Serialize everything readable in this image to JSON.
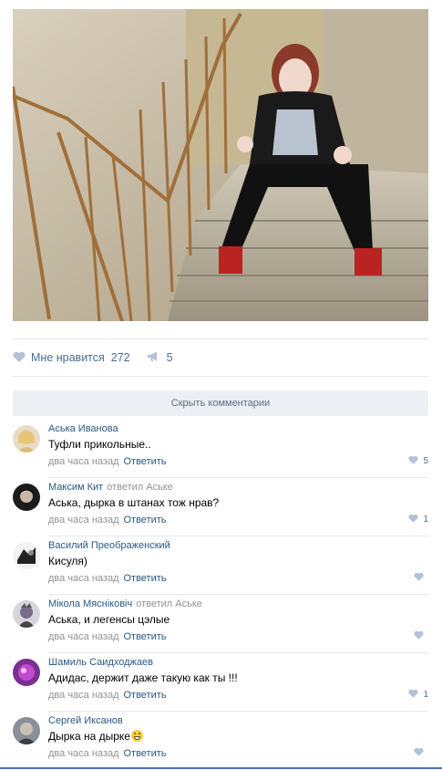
{
  "post": {
    "photo_alt": "",
    "like_label": "Мне нравится",
    "like_count": "272",
    "share_count": "5"
  },
  "comments_section": {
    "hide_label": "Скрыть комментарии"
  },
  "comments": [
    {
      "author": "Аська Иванова",
      "replied_to": "",
      "text": "Туфли прикольные..",
      "time": "два часа назад",
      "reply_label": "Ответить",
      "likes": "5"
    },
    {
      "author": "Максим Кит",
      "replied_to": "ответил Аське",
      "text": "Аська, дырка в штанах тож нрав?",
      "time": "два часа назад",
      "reply_label": "Ответить",
      "likes": "1"
    },
    {
      "author": "Василий Преображенский",
      "replied_to": "",
      "text": "Кисуля)",
      "time": "два часа назад",
      "reply_label": "Ответить",
      "likes": ""
    },
    {
      "author": "Мікола Мясніковіч",
      "replied_to": "ответил Аське",
      "text": "Аська, и легенсы цэлые",
      "time": "два часа назад",
      "reply_label": "Ответить",
      "likes": ""
    },
    {
      "author": "Шамиль Саидходжаев",
      "replied_to": "",
      "text": "Адидас, держит даже такую как ты !!!",
      "time": "два часа назад",
      "reply_label": "Ответить",
      "likes": "1"
    },
    {
      "author": "Сергей Иксанов",
      "replied_to": "",
      "text": "Дырка на дырке",
      "time": "два часа назад",
      "reply_label": "Ответить",
      "likes": ""
    }
  ],
  "colors": {
    "link": "#2a5885",
    "meta": "#939393",
    "accent": "#4a76a8"
  }
}
